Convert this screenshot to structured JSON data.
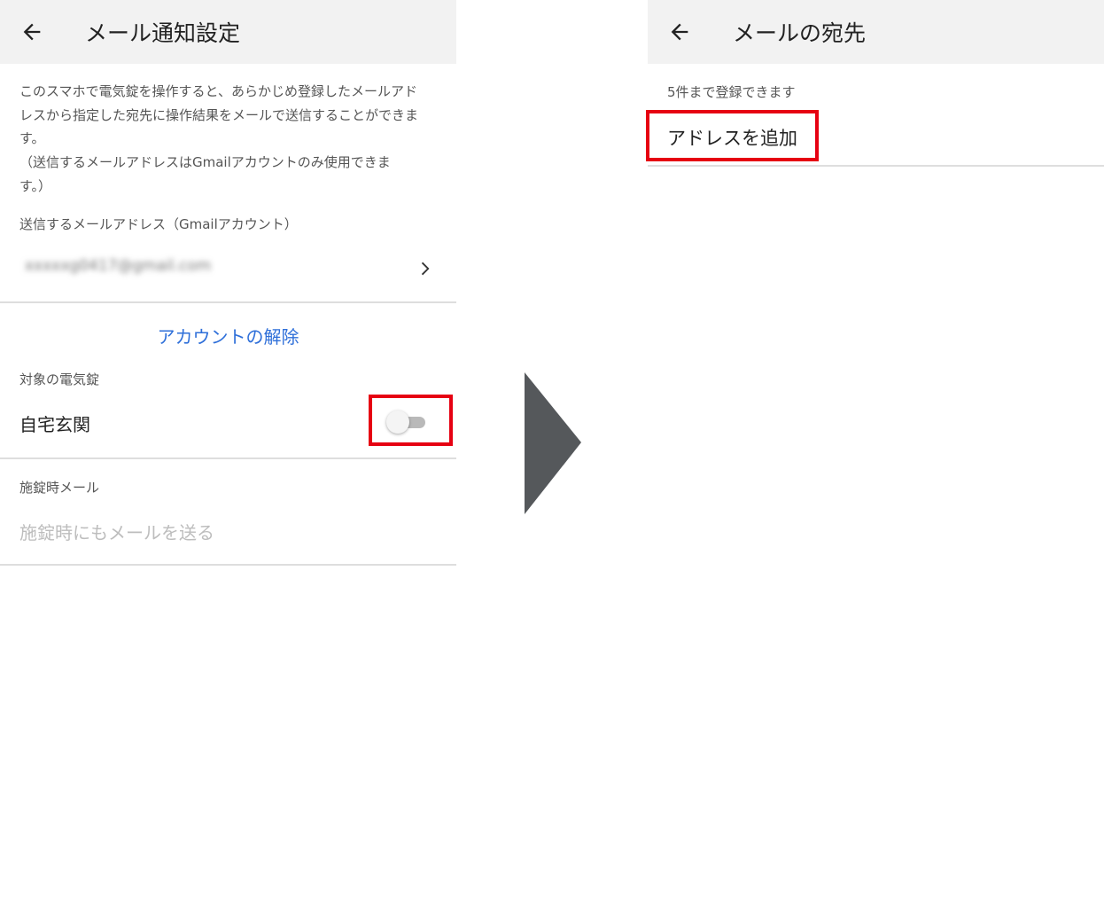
{
  "left_screen": {
    "appbar": {
      "back_icon": "arrow-left-icon",
      "title": "メール通知設定"
    },
    "description_lines": [
      "このスマホで電気錠を操作すると、あらかじめ登録したメールアド",
      "レスから指定した宛先に操作結果をメールで送信することができま",
      "す。",
      "（送信するメールアドレスはGmailアカウントのみ使用できま",
      "す。）"
    ],
    "sender_section_label": "送信するメールアドレス（Gmailアカウント）",
    "sender_email": "xxxxxg0417@gmail.com",
    "chevron_icon": "chevron-right-icon",
    "unlink_account_label": "アカウントの解除",
    "target_lock_label": "対象の電気錠",
    "target_lock_name": "自宅玄関",
    "target_lock_toggle_on": false,
    "lock_mail_section_label": "施錠時メール",
    "lock_mail_option_label": "施錠時にもメールを送る"
  },
  "right_screen": {
    "appbar": {
      "back_icon": "arrow-left-icon",
      "title": "メールの宛先"
    },
    "limit_note": "5件まで登録できます",
    "add_address_label": "アドレスを追加"
  },
  "colors": {
    "appbar_bg": "#f2f2f2",
    "link": "#2e6fd9",
    "highlight": "#e60012",
    "arrow": "#55585b",
    "divider": "#dedede"
  }
}
